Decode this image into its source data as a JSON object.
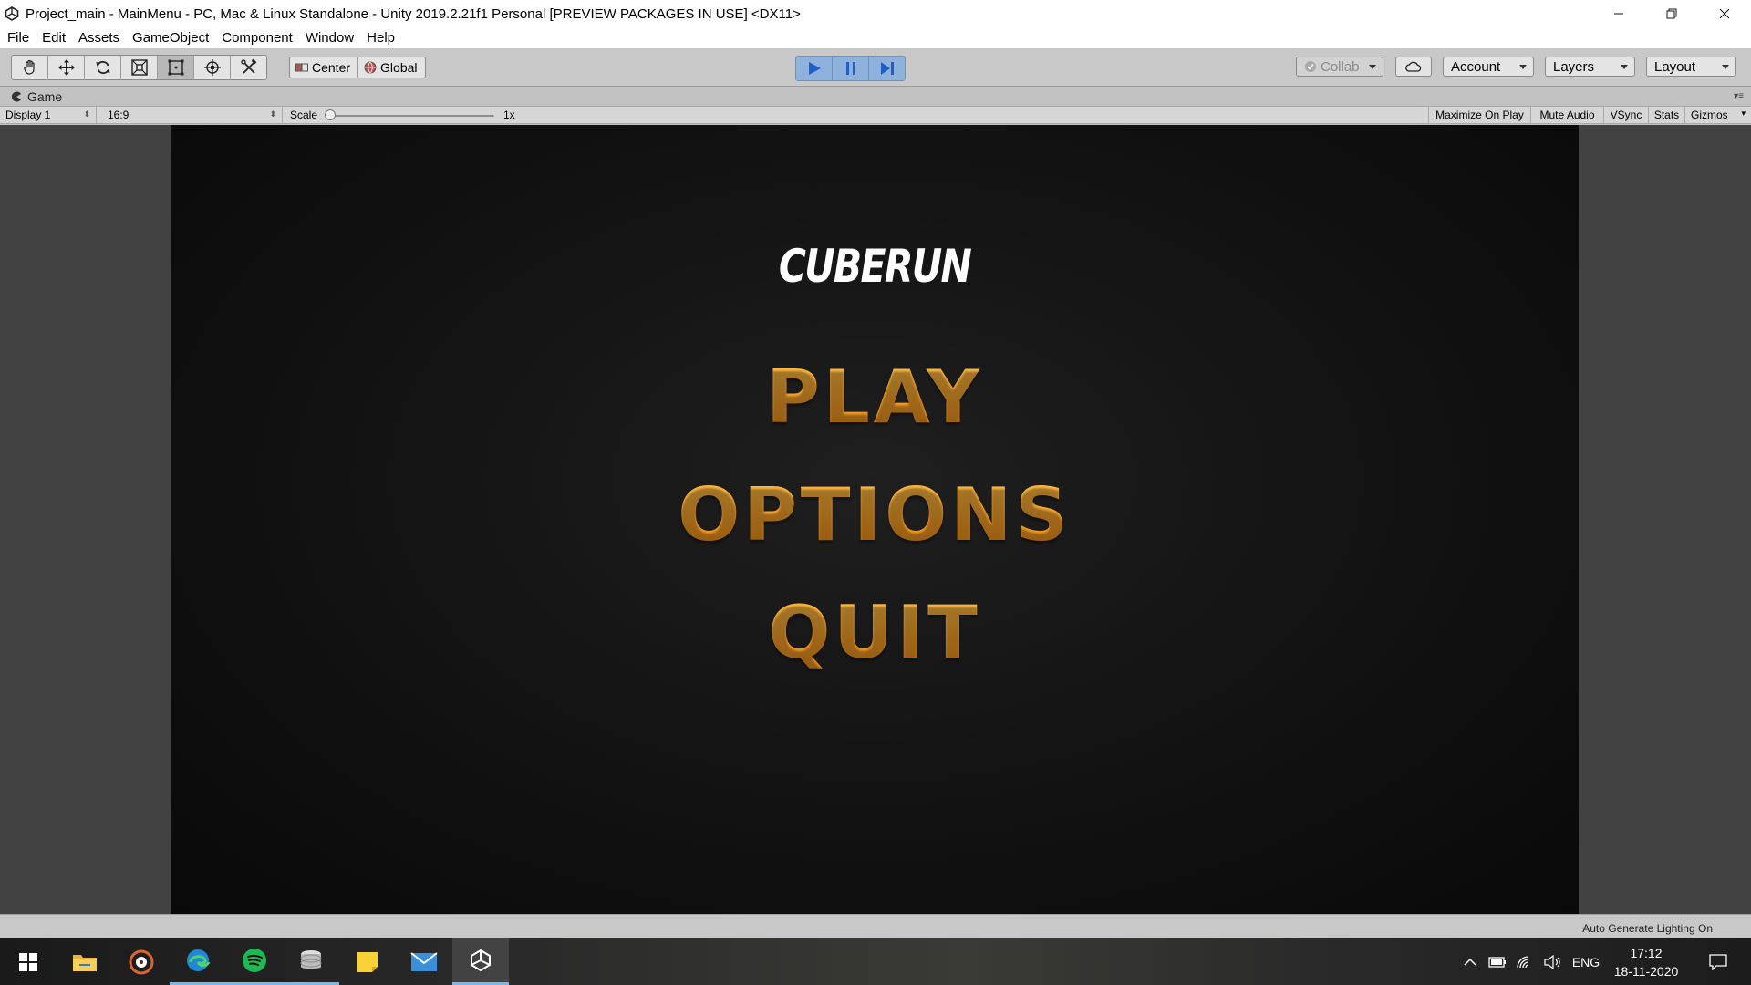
{
  "window": {
    "title": "Project_main - MainMenu - PC, Mac & Linux Standalone - Unity 2019.2.21f1 Personal [PREVIEW PACKAGES IN USE] <DX11>",
    "icon": "unity-icon"
  },
  "menu": [
    "File",
    "Edit",
    "Assets",
    "GameObject",
    "Component",
    "Window",
    "Help"
  ],
  "toolbar": {
    "tools": [
      "hand-tool-icon",
      "move-tool-icon",
      "rotate-tool-icon",
      "scale-tool-icon",
      "rect-tool-icon",
      "transform-tool-icon",
      "custom-tool-icon"
    ],
    "active_tool": "rect-tool-icon",
    "pivot_label": "Center",
    "space_label": "Global",
    "play_state": "playing",
    "collab_label": "Collab",
    "account_label": "Account",
    "layers_label": "Layers",
    "layout_label": "Layout",
    "accent": "#8fb2dc"
  },
  "panel": {
    "tab_label": "Game"
  },
  "gamebar": {
    "display": "Display 1",
    "aspect": "16:9",
    "scale_label": "Scale",
    "scale_value": "1x",
    "maximize": "Maximize On Play",
    "mute": "Mute Audio",
    "vsync": "VSync",
    "stats": "Stats",
    "gizmos": "Gizmos"
  },
  "game": {
    "title": "CUBERUN",
    "options": [
      "PLAY",
      "OPTIONS",
      "QUIT"
    ],
    "option_color": "#f5a02a",
    "background": "#141414"
  },
  "status": {
    "text": "Auto Generate Lighting On"
  },
  "taskbar": {
    "apps": [
      "windows-start-icon",
      "file-explorer-icon",
      "groove-music-icon",
      "edge-icon",
      "spotify-icon",
      "database-icon",
      "sticky-notes-icon",
      "mail-icon",
      "unity-icon"
    ],
    "language": "ENG",
    "time": "17:12",
    "date": "18-11-2020"
  }
}
